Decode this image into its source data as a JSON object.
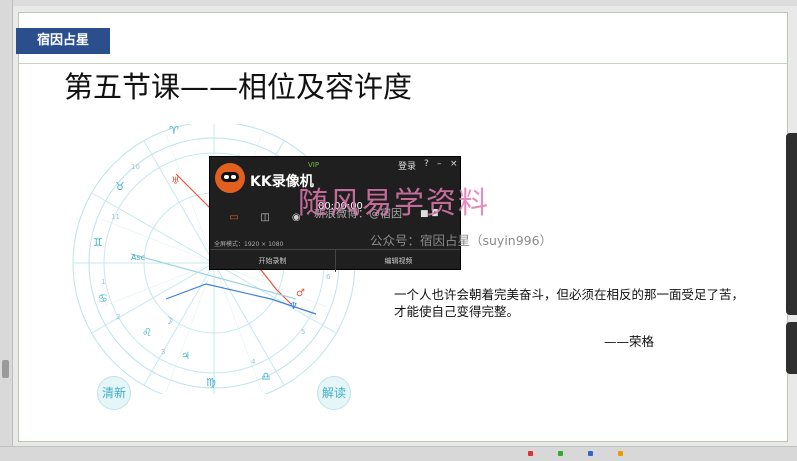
{
  "slide": {
    "brand": "宿因占星",
    "title": "第五节课——相位及容许度",
    "btn_left": "清新",
    "btn_right": "解读",
    "quote_line1": "一个人也许会朝着完美奋斗，但必须在相反的那一面受足了苦，",
    "quote_line2": "才能使自己变得完整。",
    "author": "——荣格"
  },
  "watermarks": {
    "main": "随风易学资料",
    "gzh": "公众号：宿因占星（suyin996）"
  },
  "recorder": {
    "app_name": "KK录像机",
    "vip": "VIP",
    "login": "登录",
    "help": "?",
    "minimize": "–",
    "close": "×",
    "timer": "00:00:00",
    "weibo": "新浪微博：@宿因",
    "resolution": "全屏模式：1920 × 1080",
    "btn_start": "开始录制",
    "btn_edit": "编辑视频"
  },
  "chart": {
    "signs": [
      "♈",
      "♉",
      "♊",
      "♋",
      "♌",
      "♍",
      "♎",
      "♏",
      "♐",
      "♑",
      "♒",
      "♓"
    ],
    "label_asc": "Asc",
    "aspect_colors": [
      "#e0563b",
      "#3d7fd8",
      "#3fb0c9"
    ]
  }
}
